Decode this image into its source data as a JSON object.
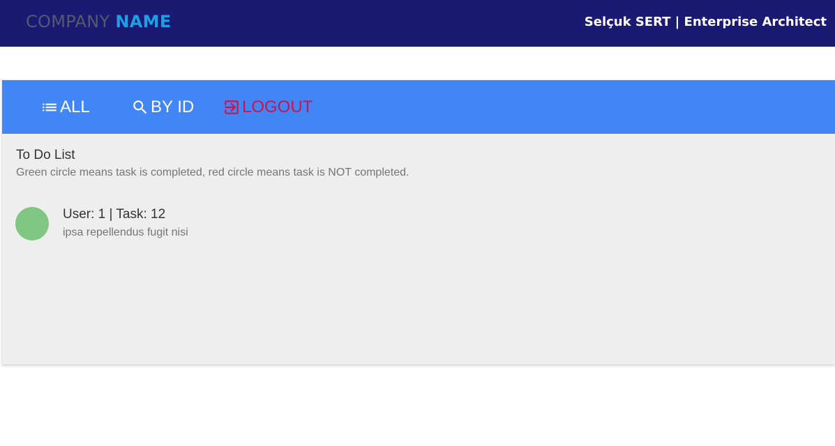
{
  "header": {
    "brand_part1": "COMPANY",
    "brand_part2": "NAME",
    "user_info": "Selçuk SERT | Enterprise Architect"
  },
  "nav": {
    "items": [
      {
        "label": "ALL",
        "icon": "list-icon"
      },
      {
        "label": "BY ID",
        "icon": "search-icon"
      },
      {
        "label": "LOGOUT",
        "icon": "logout-icon"
      }
    ]
  },
  "todo": {
    "title": "To Do List",
    "subtitle": "Green circle means task is completed, red circle means task is NOT completed.",
    "tasks": [
      {
        "title": "User: 1 | Task: 12",
        "description": "ipsa repellendus fugit nisi",
        "completed": true,
        "status_color": "#81c784"
      }
    ]
  },
  "colors": {
    "header_bg": "#1a1a72",
    "navbar_bg": "#4285f4",
    "logout": "#d0104c",
    "brand_name": "#1e9ee6",
    "completed": "#81c784",
    "card_bg": "#eeeeee"
  }
}
